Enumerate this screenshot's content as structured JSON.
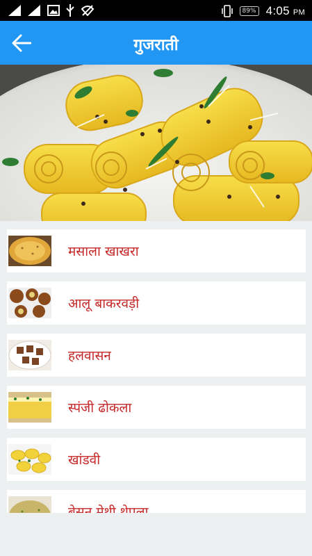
{
  "status_bar": {
    "battery": "89%",
    "time": "4:05",
    "ampm": "PM"
  },
  "app_bar": {
    "title": "गुजराती"
  },
  "recipes": [
    {
      "name": "मसाला खाखरा"
    },
    {
      "name": "आलू बाकरवड़ी"
    },
    {
      "name": "हलवासन"
    },
    {
      "name": "स्पंजी ढोकला"
    },
    {
      "name": "खांडवी"
    },
    {
      "name": "बेसन मेथी थेपला"
    }
  ],
  "colors": {
    "app_bar": "#2196f3",
    "recipe_text": "#c62828",
    "background": "#ecf0f1"
  }
}
